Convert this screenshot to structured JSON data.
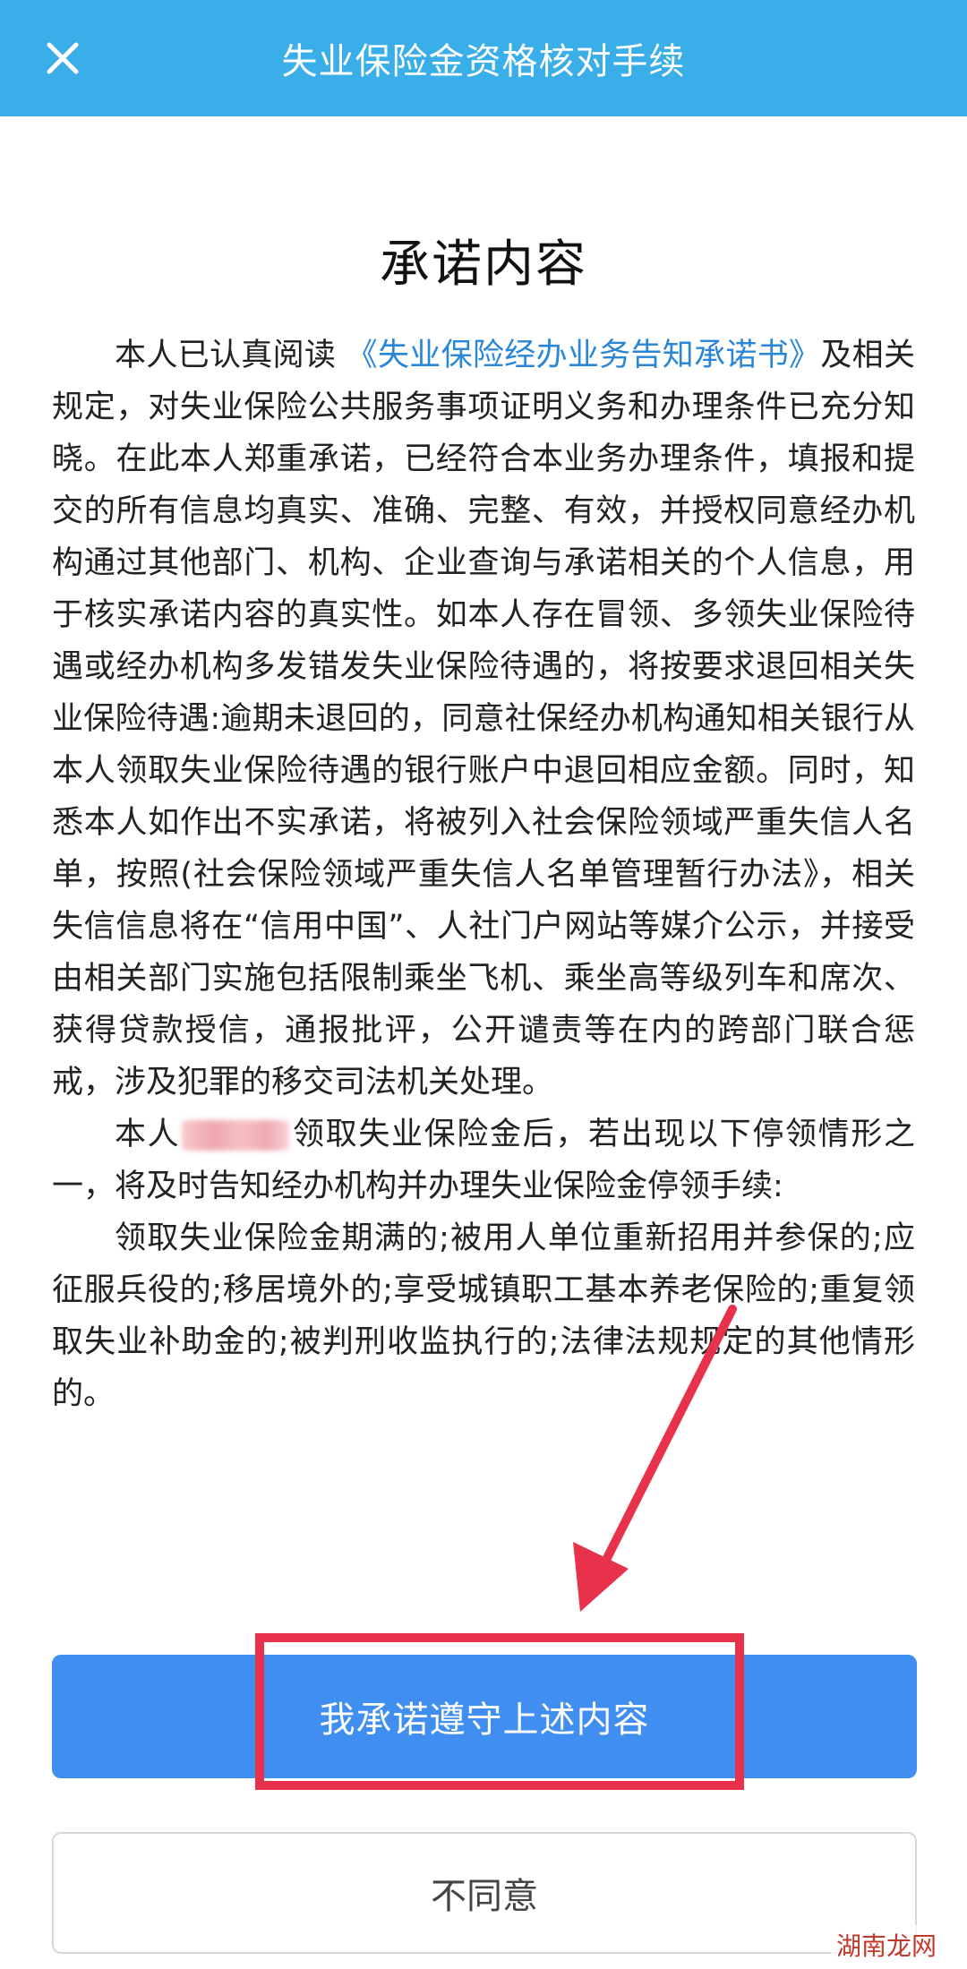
{
  "header": {
    "title": "失业保险金资格核对手续"
  },
  "content": {
    "title": "承诺内容",
    "para1_prefix": "本人已认真阅读 ",
    "para1_link": "《失业保险经办业务告知承诺书》",
    "para1_rest": "及相关规定，对失业保险公共服务事项证明义务和办理条件已充分知晓。在此本人郑重承诺，已经符合本业务办理条件，填报和提交的所有信息均真实、准确、完整、有效，并授权同意经办机构通过其他部门、机构、企业查询与承诺相关的个人信息，用于核实承诺内容的真实性。如本人存在冒领、多领失业保险待遇或经办机构多发错发失业保险待遇的，将按要求退回相关失业保险待遇:逾期未退回的，同意社保经办机构通知相关银行从本人领取失业保险待遇的银行账户中退回相应金额。同时，知悉本人如作出不实承诺，将被列入社会保险领域严重失信人名单，按照(社会保险领域严重失信人名单管理暂行办法》，相关失信信息将在“信用中国”、人社门户网站等媒介公示，并接受由相关部门实施包括限制乘坐飞机、乘坐高等级列车和席次、获得贷款授信，通报批评，公开谴责等在内的跨部门联合惩戒，涉及犯罪的移交司法机关处理。",
    "para2_prefix": "本人",
    "para2_rest": "领取失业保险金后，若出现以下停领情形之一，将及时告知经办机构并办理失业保险金停领手续:",
    "para3": "领取失业保险金期满的;被用人单位重新招用并参保的;应征服兵役的;移居境外的;享受城镇职工基本养老保险的;重复领取失业补助金的;被判刑收监执行的;法律法规规定的其他情形的。"
  },
  "buttons": {
    "agree_label": "我承诺遵守上述内容",
    "disagree_label": "不同意"
  },
  "watermark": {
    "text": "湖南龙网"
  },
  "colors": {
    "header_bg": "#39aee9",
    "primary_button": "#3f8ef0",
    "link": "#2a86d6",
    "annotation_red": "#e8314a"
  }
}
